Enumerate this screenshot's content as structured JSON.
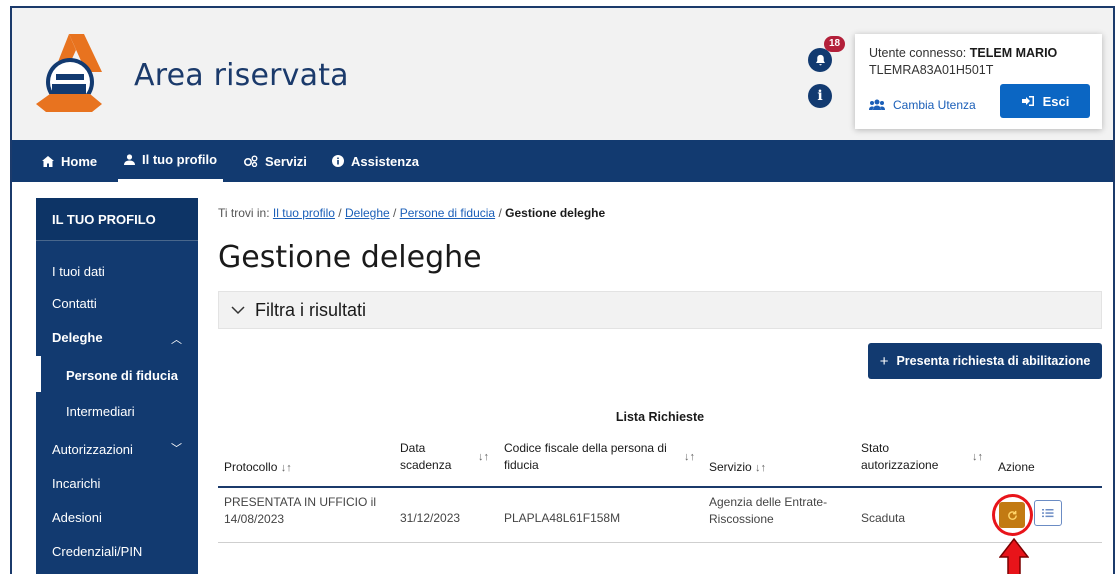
{
  "header": {
    "site_title": "Area riservata",
    "notification_count": "18",
    "user_label": "Utente connesso:",
    "user_name": "TELEM MARIO",
    "user_cf": "TLEMRA83A01H501T",
    "switch_user_label": "Cambia Utenza",
    "logout_label": "Esci"
  },
  "nav": {
    "items": [
      {
        "label": "Home",
        "icon": "home-icon"
      },
      {
        "label": "Il tuo profilo",
        "icon": "user-icon"
      },
      {
        "label": "Servizi",
        "icon": "services-icon"
      },
      {
        "label": "Assistenza",
        "icon": "info-icon"
      }
    ],
    "active": "Il tuo profilo"
  },
  "sidebar": {
    "heading": "IL TUO PROFILO",
    "items": {
      "dati": "I tuoi dati",
      "contatti": "Contatti",
      "deleghe": "Deleghe",
      "persone": "Persone di fiducia",
      "intermediari": "Intermediari",
      "autorizzazioni": "Autorizzazioni",
      "incarichi": "Incarichi",
      "adesioni": "Adesioni",
      "credenziali": "Credenziali/PIN"
    }
  },
  "breadcrumb": {
    "prefix": "Ti trovi in:",
    "links": [
      "Il tuo profilo",
      "Deleghe",
      "Persone di fiducia"
    ],
    "current": "Gestione deleghe",
    "separator": "/"
  },
  "main": {
    "title": "Gestione deleghe",
    "filter_label": "Filtra i risultati",
    "add_button": "Presenta richiesta di abilitazione",
    "table_caption": "Lista Richieste"
  },
  "table": {
    "headers": {
      "protocollo": "Protocollo",
      "data_l1": "Data",
      "data_l2": "scadenza",
      "cf_l1": "Codice fiscale della persona di",
      "cf_l2": "fiducia",
      "servizio": "Servizio",
      "stato_l1": "Stato",
      "stato_l2": "autorizzazione",
      "azione": "Azione"
    },
    "rows": [
      {
        "protocollo_l1": "PRESENTATA IN UFFICIO il",
        "protocollo_l2": "14/08/2023",
        "data": "31/12/2023",
        "cf": "PLAPLA48L61F158M",
        "servizio_l1": "Agenzia delle Entrate-",
        "servizio_l2": "Riscossione",
        "stato": "Scaduta"
      }
    ]
  },
  "colors": {
    "brand_blue": "#123a70",
    "accent_blue": "#0b66c3",
    "action_orange": "#c27a12",
    "highlight_red": "#e8141a",
    "badge_red": "#b3203a"
  }
}
